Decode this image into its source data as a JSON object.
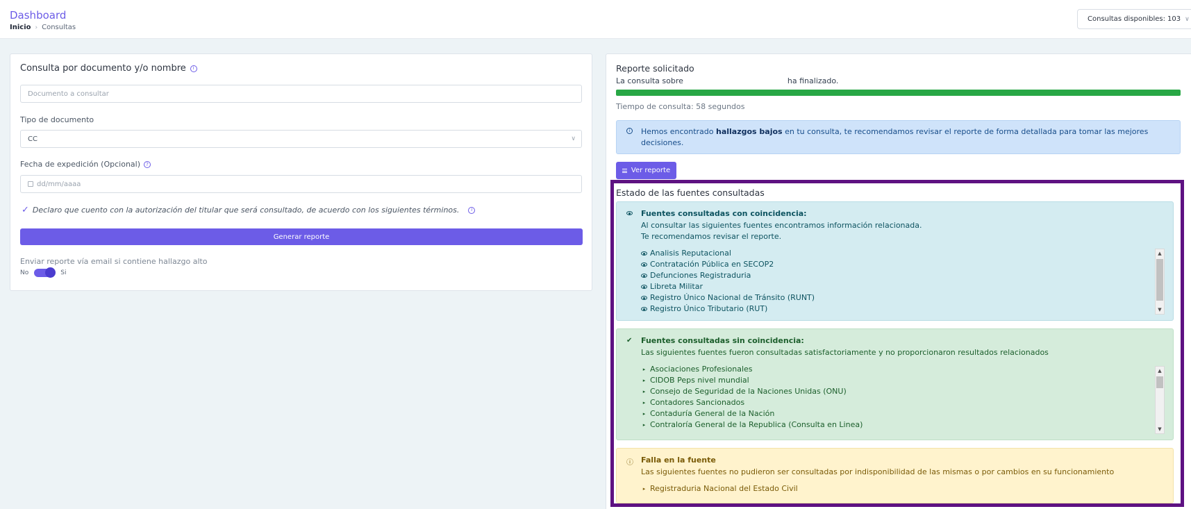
{
  "header": {
    "title": "Dashboard",
    "breadcrumb": {
      "home": "Inicio",
      "current": "Consultas"
    },
    "credits": {
      "label": "Consultas disponibles:",
      "value": "103"
    }
  },
  "form": {
    "title": "Consulta por documento y/o nombre",
    "document_placeholder": "Documento a consultar",
    "doc_type_label": "Tipo de documento",
    "doc_type_value": "CC",
    "date_label": "Fecha de expedición (Opcional)",
    "date_placeholder": "dd/mm/aaaa",
    "consent_text": "Declaro que cuento con la autorización del titular que será consultado, de acuerdo con los siguientes términos.",
    "generate_button": "Generar reporte",
    "email_label": "Enviar reporte vía email si contiene hallazgo alto",
    "toggle_off": "No",
    "toggle_on": "Si",
    "toggle_state": true
  },
  "report": {
    "title": "Reporte solicitado",
    "status_prefix": "La consulta sobre",
    "status_suffix": "ha finalizado.",
    "progress_percent": 100,
    "time_text": "Tiempo de consulta: 58 segundos",
    "alert": {
      "before": "Hemos encontrado ",
      "bold": "hallazgos bajos",
      "after": " en tu consulta, te recomendamos revisar el reporte de forma detallada para tomar las mejores decisiones."
    },
    "view_button": "Ver reporte"
  },
  "sources": {
    "title": "Estado de las fuentes consultadas",
    "with_match": {
      "title": "Fuentes consultadas con coincidencia:",
      "desc_line1": "Al consultar las siguientes fuentes encontramos información relacionada.",
      "desc_line2": "Te recomendamos revisar el reporte.",
      "items": [
        "Analisis Reputacional",
        "Contratación Pública en SECOP2",
        "Defunciones Registraduria",
        "Libreta Militar",
        "Registro Único Nacional de Tránsito (RUNT)",
        "Registro Único Tributario (RUT)"
      ]
    },
    "no_match": {
      "title": "Fuentes consultadas sin coincidencia:",
      "desc": "Las siguientes fuentes fueron consultadas satisfactoriamente y no proporcionaron resultados relacionados",
      "items": [
        "Asociaciones Profesionales",
        "CIDOB Peps nivel mundial",
        "Consejo de Seguridad de la Naciones Unidas (ONU)",
        "Contadores Sancionados",
        "Contaduría General de la Nación",
        "Contraloría General de la Republica (Consulta en Linea)"
      ]
    },
    "failure": {
      "title": "Falla en la fuente",
      "desc": "Las siguientes fuentes no pudieron ser consultadas por indisponibilidad de las mismas o por cambios en su funcionamiento",
      "items": [
        "Registraduria Nacional del Estado Civil"
      ]
    }
  },
  "colors": {
    "accent": "#6c5ce7",
    "progress": "#28a745",
    "highlight_border": "#5e1282"
  }
}
